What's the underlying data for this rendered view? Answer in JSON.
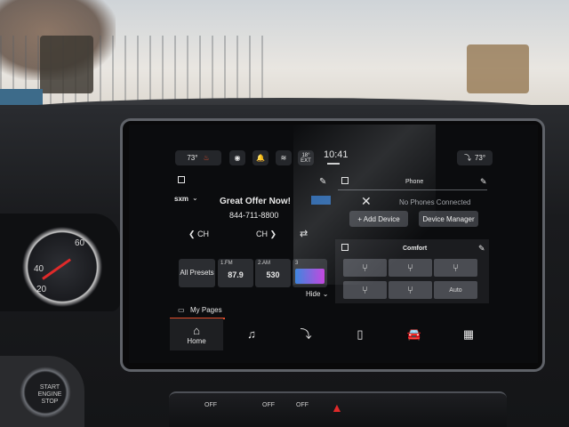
{
  "status_bar": {
    "temp_left": "73°",
    "temp_right": "73°",
    "time": "10:41",
    "ext_temp": "18°",
    "ext_label": "EXT"
  },
  "media": {
    "source": "sxm",
    "title": "Great Offer Now!",
    "phone_number": "844-711-8800",
    "ch_prev": "CH",
    "ch_next": "CH",
    "presets_label": "All Presets",
    "presets": [
      {
        "label": "1.FM",
        "value": "87.9"
      },
      {
        "label": "2.AM",
        "value": "530"
      },
      {
        "label": "3",
        "value": ""
      }
    ],
    "hide_label": "Hide"
  },
  "phone": {
    "header": "Phone",
    "status": "No Phones Connected",
    "add_device": "+ Add Device",
    "device_manager": "Device Manager"
  },
  "comfort": {
    "header": "Comfort",
    "auto_label": "Auto"
  },
  "my_pages": "My Pages",
  "nav": {
    "home_label": "Home"
  },
  "dash": {
    "gauge_numbers": [
      "40",
      "20",
      "60"
    ],
    "start_text": "START ENGINE STOP",
    "ctrl_off": [
      "OFF",
      "OFF",
      "OFF"
    ]
  },
  "colors": {
    "accent": "#e34e2b",
    "screen_bg": "#0b0c0e",
    "tile_bg": "#2b2d31",
    "seat_bg": "#4a4c52"
  }
}
